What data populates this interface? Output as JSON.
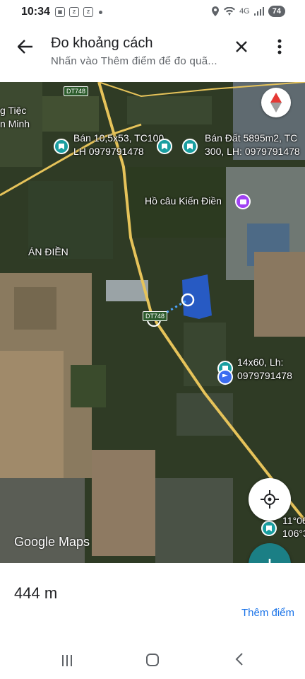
{
  "status_bar": {
    "time": "10:34",
    "icons": [
      "screenshot-icon",
      "zalo-icon",
      "zalo-icon",
      "dot-icon"
    ],
    "network": "4G",
    "battery": "74"
  },
  "header": {
    "title": "Đo khoảng cách",
    "subtitle": "Nhấn vào Thêm điểm để đo quã..."
  },
  "map": {
    "road_shield_top": "DT748",
    "road_shield_mid": "DT748",
    "labels": {
      "top_left_1": "g Tiệc",
      "top_left_2": "n Minh",
      "listing_1": "Bán 10,5x53, TC100",
      "listing_1_phone": "LH 0979791478",
      "listing_2": "Bán Đất 5895m2, TC",
      "listing_2_detail": "300, LH: 0979791478",
      "lake": "Hồ câu Kiến Điền",
      "area": "ÁN ĐIỀN",
      "listing_3": "14x60, Lh:",
      "listing_3_phone": "0979791478",
      "coord_1": "11°06",
      "coord_2": "106°3",
      "google": "Google Maps"
    },
    "colors": {
      "selection": "#2563eb",
      "pin": "#1a9ea0",
      "fab": "#1b7f85"
    }
  },
  "bottom": {
    "distance": "444 m",
    "add_point": "Thêm điểm"
  }
}
